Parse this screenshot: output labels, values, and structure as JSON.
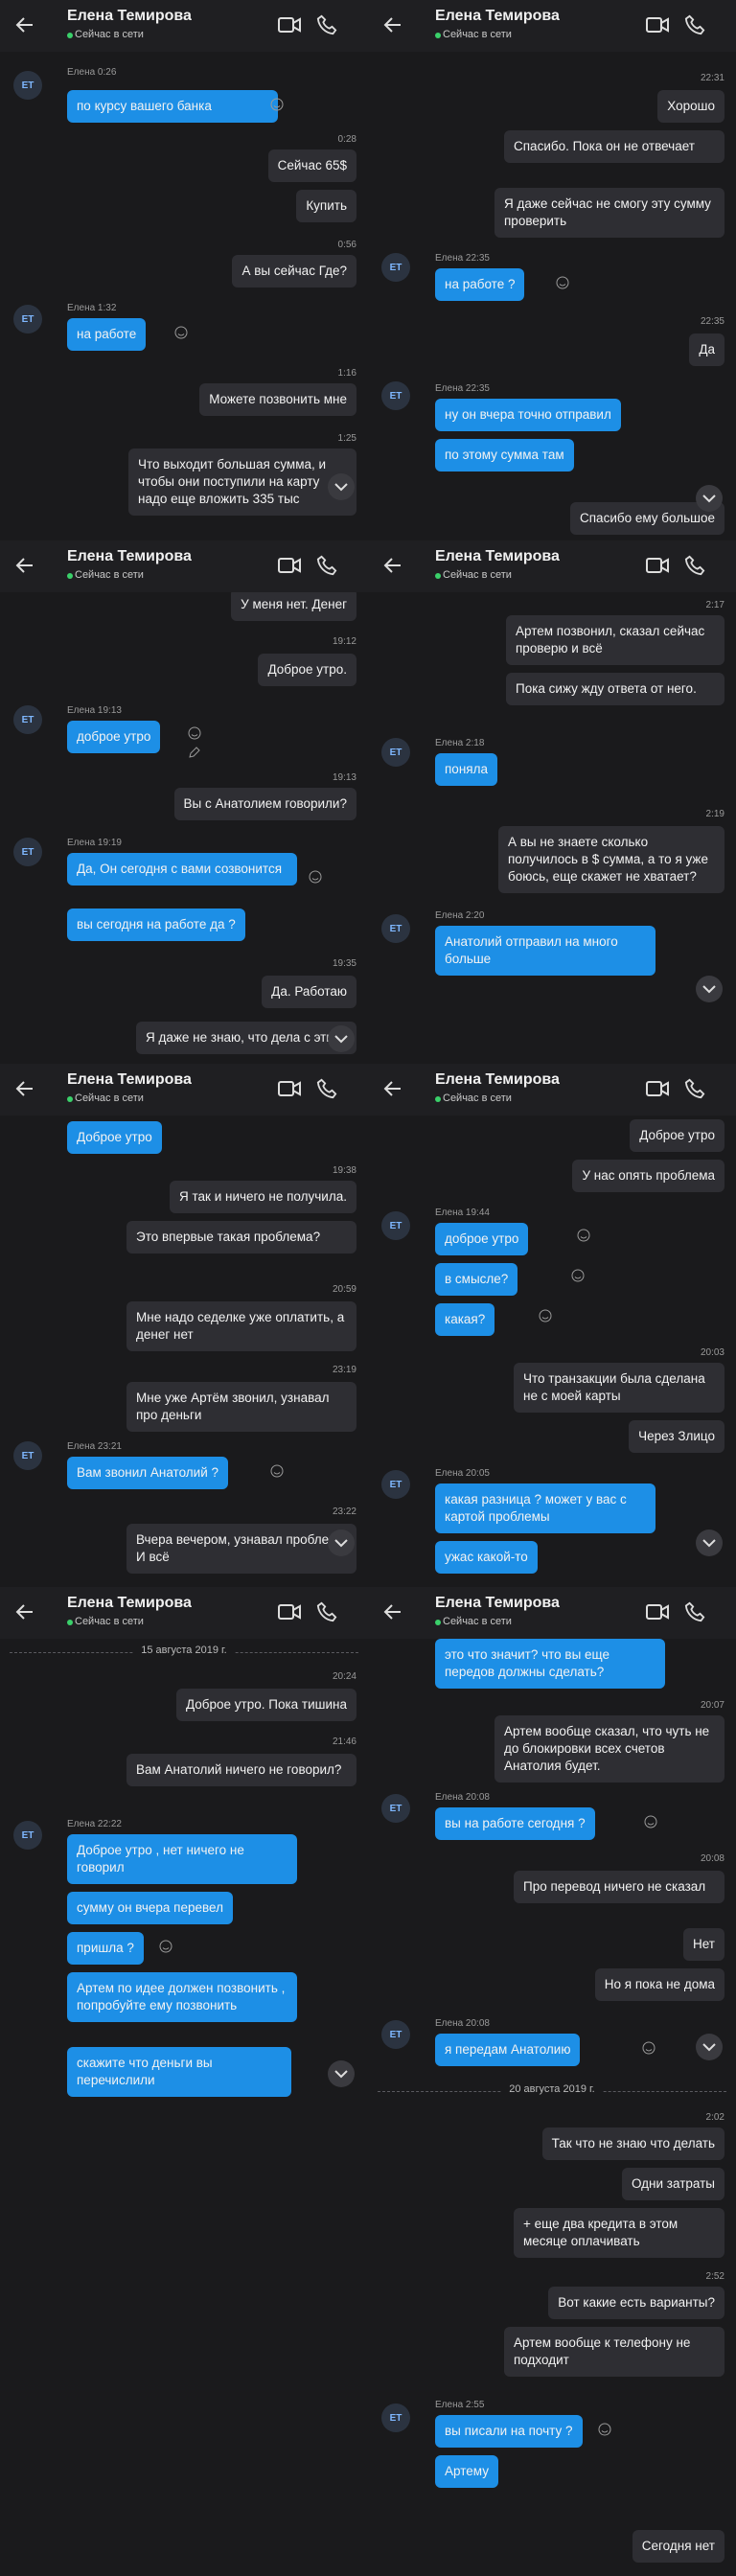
{
  "contact": {
    "name": "Елена Темирова",
    "status": "Сейчас в сети",
    "initials": "ЕТ"
  },
  "colors": {
    "background": "#1a1a1c",
    "incoming_bubble": "#1d8fe6",
    "outgoing_bubble": "#2e2e33",
    "online": "#3ad06a"
  },
  "icons": [
    "back-arrow-icon",
    "video-call-icon",
    "phone-call-icon",
    "smile-icon",
    "chevron-down-icon",
    "edit-icon"
  ],
  "panels": [
    {
      "messages": [
        {
          "t": "Елена 0:26",
          "text": "по курсу вашего банка"
        },
        {
          "t": "0:28",
          "text": "Сейчас 65$"
        },
        {
          "text": "Купить"
        },
        {
          "t": "0:56",
          "text": "А вы сейчас Где?"
        },
        {
          "t": "Елена 1:32",
          "text": "на работе"
        },
        {
          "t": "1:16",
          "text": "Можете позвонить мне"
        },
        {
          "t": "1:25",
          "text": "Что выходит большая сумма, и чтобы они поступили на карту надо еще вложить 335 тыс"
        }
      ]
    },
    {
      "messages": [
        {
          "t": "22:31",
          "text": "Хорошо"
        },
        {
          "text": "Спасибо. Пока он не отвечает"
        },
        {
          "text": "Я даже сейчас не смогу эту сумму проверить"
        },
        {
          "t": "Елена 22:35",
          "text": "на работе ?"
        },
        {
          "t": "22:35",
          "text": "Да"
        },
        {
          "t": "Елена 22:35",
          "text": "ну он вчера точно отправил"
        },
        {
          "text": "по этому сумма там"
        },
        {
          "text": "Спасибо ему большое"
        }
      ]
    },
    {
      "messages": [
        {
          "text": "У меня нет. Денег"
        },
        {
          "t": "19:12",
          "text": "Доброе утро."
        },
        {
          "t": "Елена 19:13",
          "text": "доброе утро"
        },
        {
          "t": "19:13",
          "text": "Вы с Анатолием говорили?"
        },
        {
          "t": "Елена 19:19",
          "text": "Да, Он сегодня с вами созвонится"
        },
        {
          "text": "вы сегодня на работе да ?"
        },
        {
          "t": "19:35",
          "text": "Да. Работаю"
        },
        {
          "text": "Я даже не знаю, что дела с этим"
        }
      ]
    },
    {
      "messages": [
        {
          "t": "2:17",
          "text": "Артем позвонил, сказал сейчас проверю и всё"
        },
        {
          "text": "Пока сижу жду ответа от него."
        },
        {
          "t": "Елена 2:18",
          "text": "поняла"
        },
        {
          "t": "2:19",
          "text": "А вы не знаете сколько получилось в $ сумма, а то я уже боюсь, еще скажет не хватает?"
        },
        {
          "t": "Елена 2:20",
          "text": "Анатолий отправил на много больше"
        }
      ]
    },
    {
      "messages": [
        {
          "text": "Доброе утро"
        },
        {
          "t": "19:38",
          "text": "Я так и ничего не получила."
        },
        {
          "text": "Это впервые такая проблема?"
        },
        {
          "t": "20:59",
          "text": "Мне надо седелке уже оплатить, а денег нет"
        },
        {
          "t": "23:19",
          "text": "Мне уже Артём звонил, узнавал про деньги"
        },
        {
          "t": "Елена 23:21",
          "text": "Вам звонил Анатолий ?"
        },
        {
          "t": "23:22",
          "text": "Вчера вечером, узнавал проблему. И всё"
        }
      ]
    },
    {
      "messages": [
        {
          "text": "Доброе утро"
        },
        {
          "text": "У нас опять проблема"
        },
        {
          "t": "Елена 19:44",
          "text": "доброе утро"
        },
        {
          "text": "в смысле?"
        },
        {
          "text": "какая?"
        },
        {
          "t": "20:03",
          "text": "Что транзакции была сделана не с моей карты"
        },
        {
          "text": "Через Злицо"
        },
        {
          "t": "Елена 20:05",
          "text": "какая разница ? может у вас с картой проблемы"
        },
        {
          "text": "ужас какой-то"
        }
      ]
    },
    {
      "date": "15 августа 2019 г.",
      "messages": [
        {
          "t": "20:24",
          "text": "Доброе утро. Пока тишина"
        },
        {
          "t": "21:46",
          "text": "Вам Анатолий ничего не говорил?"
        },
        {
          "t": "Елена 22:22",
          "text": "Доброе утро , нет ничего не говорил"
        },
        {
          "text": "сумму он вчера перевел"
        },
        {
          "text": "пришла ?"
        },
        {
          "text": "Артем по идее должен позвонить , попробуйте ему позвонить"
        },
        {
          "text": "скажите что деньги вы перечислили"
        }
      ]
    },
    {
      "date": "20 августа 2019 г.",
      "messages": [
        {
          "text": "это что значит? что вы еще передов должны сделать?"
        },
        {
          "t": "20:07",
          "text": "Артем вообще сказал, что чуть не до блокировки всех счетов Анатолия будет."
        },
        {
          "t": "Елена 20:08",
          "text": "вы на работе сегодня ?"
        },
        {
          "t": "20:08",
          "text": "Про перевод ничего не сказал"
        },
        {
          "text": "Нет"
        },
        {
          "text": "Но я пока не дома"
        },
        {
          "t": "Елена 20:08",
          "text": "я передам Анатолию"
        },
        {
          "t": "2:02",
          "text": "Так что не знаю что делать"
        },
        {
          "text": "Одни затраты"
        },
        {
          "text": "+ еще два кредита в этом месяце оплачивать"
        },
        {
          "t": "2:52",
          "text": "Вот какие есть варианты?"
        },
        {
          "text": "Артем вообще к телефону не подходит"
        },
        {
          "t": "Елена 2:55",
          "text": "вы писали на почту ?"
        },
        {
          "text": "Артему"
        },
        {
          "text": "Сегодня нет"
        }
      ]
    }
  ]
}
